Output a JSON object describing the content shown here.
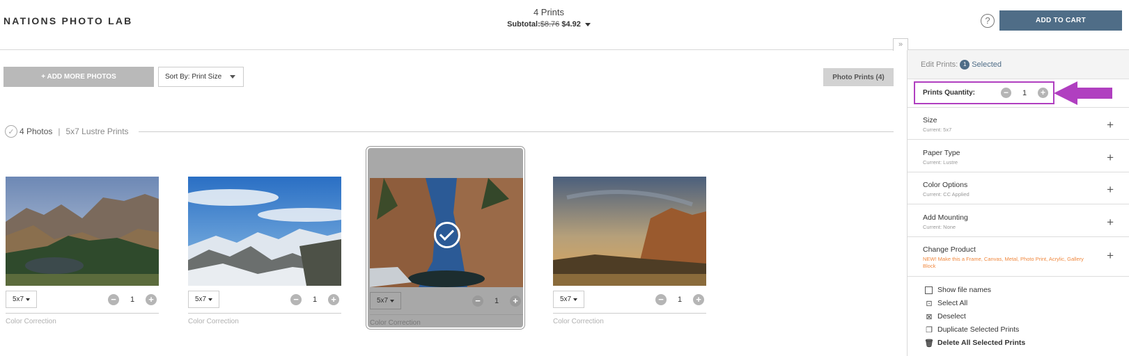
{
  "header": {
    "logo": "NATIONS PHOTO LAB",
    "print_count": "4 Prints",
    "subtotal_label": "Subtotal:",
    "subtotal_old": "$8.76",
    "subtotal_new": "$4.92",
    "help_glyph": "?",
    "add_to_cart": "ADD TO CART",
    "collapse_glyph": "»"
  },
  "toolbar": {
    "add_photos": "+ ADD MORE PHOTOS",
    "sort_label": "Sort By: Print Size",
    "photo_prints": "Photo Prints (4)"
  },
  "group": {
    "count": "4 Photos",
    "separator": "|",
    "desc": "5x7 Lustre Prints"
  },
  "cards": [
    {
      "size": "5x7",
      "qty": "1",
      "cc": "Color Correction",
      "selected": false
    },
    {
      "size": "5x7",
      "qty": "1",
      "cc": "Color Correction",
      "selected": false
    },
    {
      "size": "5x7",
      "qty": "1",
      "cc": "Color Correction",
      "selected": true
    },
    {
      "size": "5x7",
      "qty": "1",
      "cc": "Color Correction",
      "selected": false
    }
  ],
  "panel": {
    "edit_label": "Edit Prints:",
    "selected_count": "1",
    "selected_word": "Selected",
    "qty_label": "Prints Quantity:",
    "qty_value": "1",
    "options": [
      {
        "title": "Size",
        "sub": "Current: 5x7"
      },
      {
        "title": "Paper Type",
        "sub": "Current: Lustre"
      },
      {
        "title": "Color Options",
        "sub": "Current: CC Applied"
      },
      {
        "title": "Add Mounting",
        "sub": "Current: None"
      },
      {
        "title": "Change Product",
        "sub": "NEW! Make this a Frame, Canvas, Metal, Photo Print, Acrylic, Gallery Block"
      }
    ],
    "actions": {
      "show_names": "Show file names",
      "select_all": "Select All",
      "deselect": "Deselect",
      "duplicate": "Duplicate Selected Prints",
      "delete_all": "Delete All Selected Prints"
    }
  },
  "colors": {
    "accent": "#4f6d87",
    "highlight": "#b03fc0",
    "new_orange": "#f0883e"
  }
}
